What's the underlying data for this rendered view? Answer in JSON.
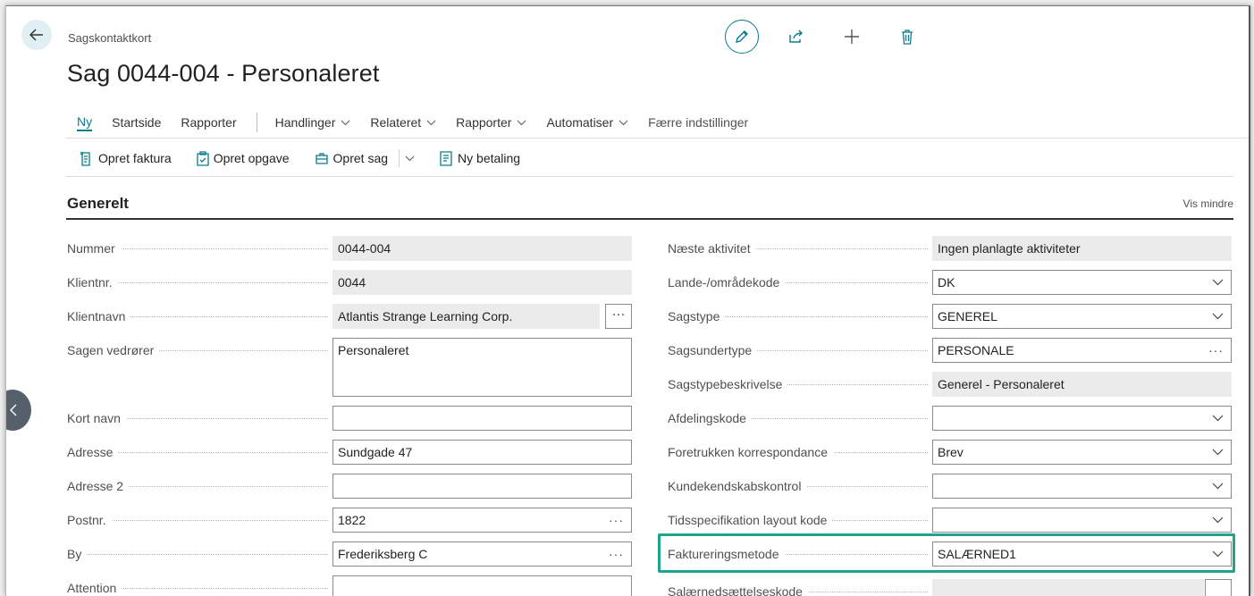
{
  "header": {
    "breadcrumb": "Sagskontaktkort",
    "title": "Sag 0044-004 - Personaleret"
  },
  "nav": {
    "items": [
      {
        "label": "Ny",
        "active": true
      },
      {
        "label": "Startside"
      },
      {
        "label": "Rapporter"
      }
    ],
    "dropdowns": [
      {
        "label": "Handlinger"
      },
      {
        "label": "Relateret"
      },
      {
        "label": "Rapporter"
      },
      {
        "label": "Automatiser"
      }
    ],
    "fewer": "Færre indstillinger"
  },
  "actions": {
    "create_invoice": "Opret faktura",
    "create_task": "Opret opgave",
    "create_case": "Opret sag",
    "new_payment": "Ny betaling"
  },
  "section": {
    "title": "Generelt",
    "show_less": "Vis mindre"
  },
  "left_fields": [
    {
      "label": "Nummer",
      "value": "0044-004"
    },
    {
      "label": "Klientnr.",
      "value": "0044"
    },
    {
      "label": "Klientnavn",
      "value": "Atlantis Strange Learning Corp.",
      "ellipsis": "···"
    },
    {
      "label": "Sagen vedrører",
      "value": "Personaleret"
    },
    {
      "label": "Kort navn",
      "value": ""
    },
    {
      "label": "Adresse",
      "value": "Sundgade 47"
    },
    {
      "label": "Adresse 2",
      "value": ""
    },
    {
      "label": "Postnr.",
      "value": "1822",
      "ellipsis": "···"
    },
    {
      "label": "By",
      "value": "Frederiksberg C",
      "ellipsis": "···"
    },
    {
      "label": "Attention",
      "value": ""
    }
  ],
  "right_fields": [
    {
      "label": "Næste aktivitet",
      "value": "Ingen planlagte aktiviteter"
    },
    {
      "label": "Lande-/områdekode",
      "value": "DK"
    },
    {
      "label": "Sagstype",
      "value": "GENEREL"
    },
    {
      "label": "Sagsundertype",
      "value": "PERSONALE",
      "ellipsis": "···"
    },
    {
      "label": "Sagstypebeskrivelse",
      "value": "Generel - Personaleret"
    },
    {
      "label": "Afdelingskode",
      "value": ""
    },
    {
      "label": "Foretrukken korrespondance",
      "value": "Brev"
    },
    {
      "label": "Kundekendskabskontrol",
      "value": ""
    },
    {
      "label": "Tidsspecifikation layout kode",
      "value": ""
    },
    {
      "label": "Faktureringsmetode",
      "value": "SALÆRNED1"
    },
    {
      "label": "Salærnedsættelseskode",
      "value": ""
    }
  ],
  "colors": {
    "accent": "#0b7b8b",
    "highlight": "#1fa38a"
  }
}
